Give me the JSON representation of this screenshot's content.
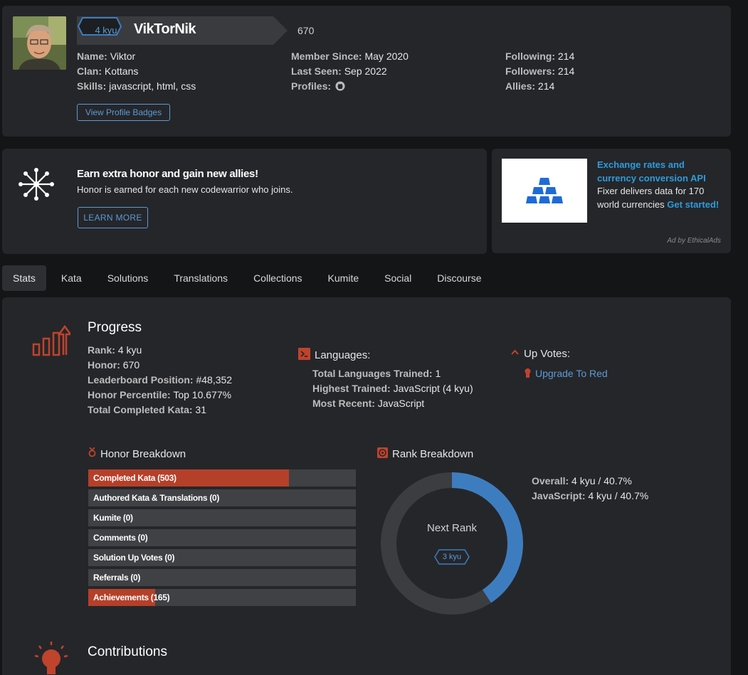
{
  "profile": {
    "rank_badge": "4 kyu",
    "username": "VikTorNik",
    "honor": "670",
    "col1": [
      {
        "label": "Name:",
        "value": "Viktor"
      },
      {
        "label": "Clan:",
        "value": "Kottans"
      },
      {
        "label": "Skills:",
        "value": "javascript, html, css"
      }
    ],
    "col2": [
      {
        "label": "Member Since:",
        "value": "May 2020"
      },
      {
        "label": "Last Seen:",
        "value": "Sep 2022"
      },
      {
        "label": "Profiles:",
        "value": ""
      }
    ],
    "col3": [
      {
        "label": "Following:",
        "value": "214"
      },
      {
        "label": "Followers:",
        "value": "214"
      },
      {
        "label": "Allies:",
        "value": "214"
      }
    ],
    "badges_button": "View Profile Badges"
  },
  "promo": {
    "title": "Earn extra honor and gain new allies!",
    "subtitle": "Honor is earned for each new codewarrior who joins.",
    "button": "LEARN MORE"
  },
  "ad": {
    "link_title": "Exchange rates and currency conversion API",
    "body": "Fixer delivers data for 170 world currencies",
    "cta": "Get started!",
    "attribution": "Ad by EthicalAds"
  },
  "tabs": [
    "Stats",
    "Kata",
    "Solutions",
    "Translations",
    "Collections",
    "Kumite",
    "Social",
    "Discourse"
  ],
  "progress": {
    "title": "Progress",
    "items": [
      {
        "label": "Rank:",
        "value": "4 kyu"
      },
      {
        "label": "Honor:",
        "value": "670"
      },
      {
        "label": "Leaderboard Position:",
        "value": "#48,352"
      },
      {
        "label": "Honor Percentile:",
        "value": "Top 10.677%"
      },
      {
        "label": "Total Completed Kata:",
        "value": "31"
      }
    ]
  },
  "languages": {
    "title": "Languages:",
    "items": [
      {
        "label": "Total Languages Trained:",
        "value": "1"
      },
      {
        "label": "Highest Trained:",
        "value": "JavaScript (4 kyu)"
      },
      {
        "label": "Most Recent:",
        "value": "JavaScript"
      }
    ]
  },
  "upvotes": {
    "title": "Up Votes:",
    "link": "Upgrade To Red"
  },
  "honor_breakdown": {
    "title": "Honor Breakdown",
    "bars": [
      {
        "label": "Completed Kata (503)",
        "fill": 0.75
      },
      {
        "label": "Authored Kata & Translations (0)",
        "fill": 0
      },
      {
        "label": "Kumite (0)",
        "fill": 0
      },
      {
        "label": "Comments (0)",
        "fill": 0
      },
      {
        "label": "Solution Up Votes (0)",
        "fill": 0
      },
      {
        "label": "Referrals (0)",
        "fill": 0
      },
      {
        "label": "Achievements (165)",
        "fill": 0.25
      }
    ]
  },
  "rank_breakdown": {
    "title": "Rank Breakdown",
    "center_label": "Next Rank",
    "next_rank": "3 kyu",
    "progress": 0.407,
    "items": [
      {
        "label": "Overall:",
        "value": "4 kyu / 40.7%"
      },
      {
        "label": "JavaScript:",
        "value": "4 kyu / 40.7%"
      }
    ]
  },
  "contributions": {
    "title": "Contributions"
  },
  "colors": {
    "accent_red": "#b5402a",
    "rank_blue": "#3d7dbf",
    "link_blue": "#5b9bd5"
  }
}
